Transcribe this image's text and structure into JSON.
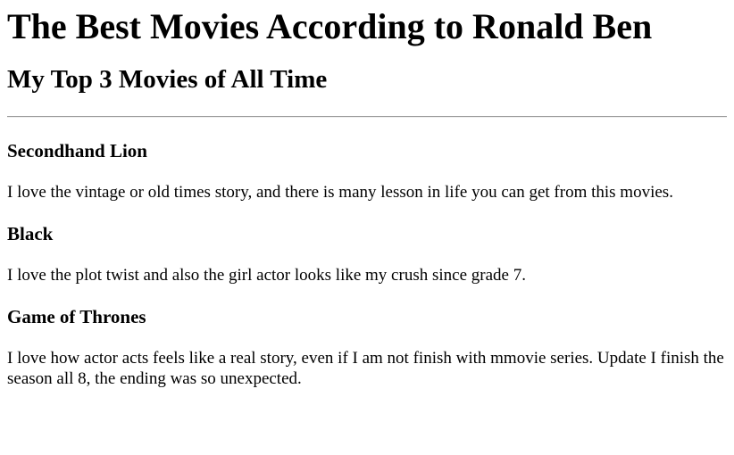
{
  "page": {
    "title": "The Best Movies According to Ronald Ben",
    "subtitle": "My Top 3 Movies of All Time"
  },
  "movies": [
    {
      "title": "Secondhand Lion",
      "description": "I love the vintage or old times story, and there is many lesson in life you can get from this movies."
    },
    {
      "title": "Black",
      "description": "I love the plot twist and also the girl actor looks like my crush since grade 7."
    },
    {
      "title": "Game of Thrones",
      "description": "I love how actor acts feels like a real story, even if I am not finish with mmovie series. Update I finish the season all 8, the ending was so unexpected."
    }
  ]
}
